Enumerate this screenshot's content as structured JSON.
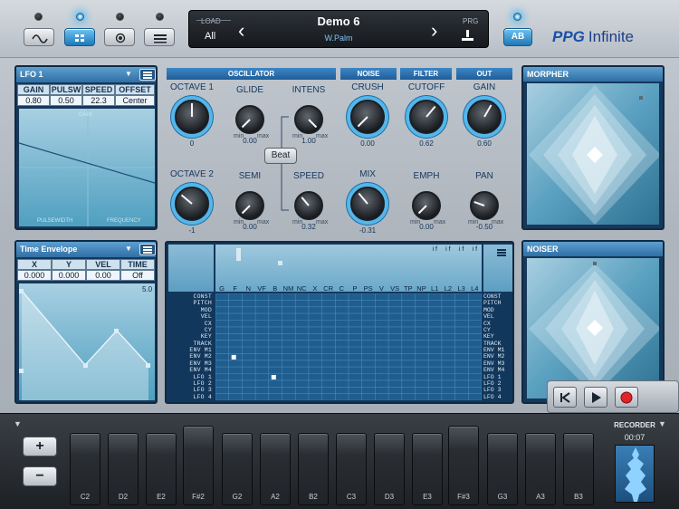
{
  "header": {
    "load_label": "LOAD",
    "load_bank": "All",
    "preset_name": "Demo 6",
    "preset_author": "W.Palm",
    "prg_label": "PRG",
    "prev_arrow": "‹",
    "next_arrow": "›",
    "ab_label": "AB",
    "logo_mark": "PPG",
    "logo_text": "Infinite",
    "view_buttons": [
      "wave-icon",
      "matrix-icon",
      "record-view-icon",
      "list-icon"
    ]
  },
  "lfo": {
    "title": "LFO 1",
    "headers": [
      "GAIN",
      "PULSW",
      "SPEED",
      "OFFSET"
    ],
    "values": [
      "0.80",
      "0.50",
      "22.3",
      "Center"
    ],
    "graph_labels": {
      "top": "GAIN",
      "left": "PULSEWIDTH",
      "right": "FREQUENCY"
    }
  },
  "envelope": {
    "title": "Time Envelope",
    "headers": [
      "X",
      "Y",
      "VEL",
      "TIME"
    ],
    "values": [
      "0.000",
      "0.000",
      "0.00",
      "Off"
    ],
    "time_value": "5.0"
  },
  "sections": {
    "oscillator": "OSCILLATOR",
    "noise": "NOISE",
    "filter": "FILTER",
    "out": "OUT"
  },
  "knobs": [
    {
      "label": "OCTAVE 1",
      "value": "0",
      "angle": 0,
      "big": true,
      "minmax": false
    },
    {
      "label": "GLIDE",
      "value": "0.00",
      "angle": -135,
      "big": false,
      "minmax": true
    },
    {
      "label": "INTENS",
      "value": "1.00",
      "angle": 135,
      "big": false,
      "minmax": true
    },
    {
      "label": "CRUSH",
      "value": "0.00",
      "angle": -135,
      "big": true,
      "minmax": false
    },
    {
      "label": "CUTOFF",
      "value": "0.62",
      "angle": 40,
      "big": true,
      "minmax": false
    },
    {
      "label": "GAIN",
      "value": "0.60",
      "angle": 30,
      "big": true,
      "minmax": false
    },
    {
      "label": "OCTAVE 2",
      "value": "-1",
      "angle": -50,
      "big": true,
      "minmax": false
    },
    {
      "label": "SEMI",
      "value": "0.00",
      "angle": -135,
      "big": false,
      "minmax": true
    },
    {
      "label": "SPEED",
      "value": "0.32",
      "angle": -40,
      "big": false,
      "minmax": true
    },
    {
      "label": "MIX",
      "value": "-0.31",
      "angle": -40,
      "big": true,
      "minmax": false
    },
    {
      "label": "EMPH",
      "value": "0.00",
      "angle": -135,
      "big": false,
      "minmax": true
    },
    {
      "label": "PAN",
      "value": "-0.50",
      "angle": -70,
      "big": false,
      "minmax": true
    }
  ],
  "minmax": {
    "min": "min",
    "max": "max"
  },
  "beat_label": "Beat",
  "matrix": {
    "columns": [
      "G",
      "F",
      "N",
      "VF",
      "B",
      "NM",
      "NC",
      "X",
      "CR",
      "C",
      "P",
      "PS",
      "V",
      "VS",
      "TP",
      "NP",
      "L1",
      "L2",
      "L3",
      "L4"
    ],
    "rows": [
      "CONST",
      "PITCH",
      "MOD",
      "VEL",
      "CX",
      "CY",
      "KEY",
      "TRACK",
      "ENV M1",
      "ENV M2",
      "ENV M3",
      "ENV M4",
      "LFO 1",
      "LFO 2",
      "LFO 3",
      "LFO 4"
    ],
    "if_label": "i f"
  },
  "morpher": {
    "title": "MORPHER"
  },
  "noiser": {
    "title": "NOISER"
  },
  "transport": {
    "rewind": "K",
    "play": "▶",
    "record": "●"
  },
  "recorder": {
    "label": "RECORDER",
    "time": "00:07"
  },
  "keyboard": {
    "octave_up": "+",
    "octave_down": "−",
    "white_keys": [
      "C2",
      "D2",
      "E2",
      "G2",
      "A2",
      "B2",
      "C3",
      "D3",
      "E3",
      "G3",
      "A3",
      "B3"
    ],
    "raised_keys": [
      "F#2",
      "F#3"
    ]
  }
}
